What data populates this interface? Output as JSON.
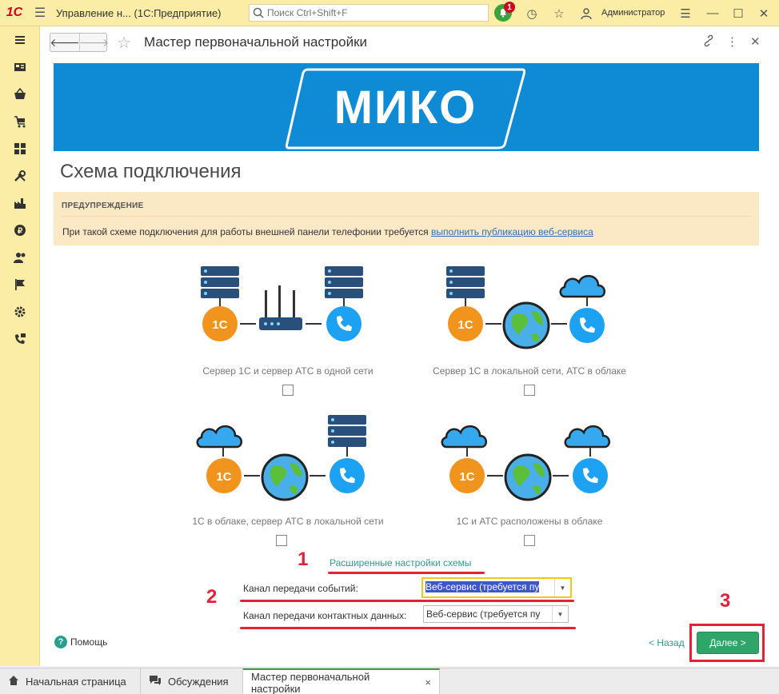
{
  "app": {
    "logo": "1С",
    "title": "Управление н...  (1С:Предприятие)",
    "search_placeholder": "Поиск Ctrl+Shift+F",
    "notifications_count": "1",
    "user": "Администратор"
  },
  "sidebar": {
    "items": [
      "menu-icon",
      "desktop-icon",
      "purchases-icon",
      "sales-icon",
      "catalog-icon",
      "tools-icon",
      "production-icon",
      "finance-icon",
      "contacts-icon",
      "flag-icon",
      "settings-icon",
      "telephony-icon"
    ]
  },
  "form": {
    "title": "Мастер первоначальной настройки",
    "banner_logo": "МИКО",
    "section_title": "Схема подключения",
    "warning": {
      "heading": "ПРЕДУПРЕЖДЕНИЕ",
      "text": "При такой схеме подключения для работы внешней панели телефонии требуется ",
      "link": "выполнить публикацию веб-сервиса"
    },
    "schemas": [
      {
        "label": "Сервер 1С и сервер АТС в одной сети",
        "checked": false
      },
      {
        "label": "Сервер 1С в локальной сети, АТС в облаке",
        "checked": false
      },
      {
        "label": "1С в облаке, сервер АТС в локальной сети",
        "checked": false
      },
      {
        "label": "1С и АТС расположены в облаке",
        "checked": false
      }
    ],
    "advanced_link": "Расширенные настройки схемы",
    "event_channel_label": "Канал передачи событий:",
    "event_channel_value": "Веб-сервис (требуется пу",
    "contact_channel_label": "Канал передачи контактных данных:",
    "contact_channel_value": "Веб-сервис (требуется пу",
    "help": "Помощь",
    "back": "< Назад",
    "next": "Далее >"
  },
  "annotations": [
    "1",
    "2",
    "3"
  ],
  "tabs": [
    {
      "label": "Начальная страница",
      "icon": "home-icon"
    },
    {
      "label": "Обсуждения",
      "icon": "chat-icon"
    },
    {
      "label": "Мастер первоначальной настройки",
      "close": "×"
    }
  ],
  "colors": {
    "panel": "#fbeda6",
    "banner": "#0f8bd6",
    "accent": "#2fa56a",
    "annotation": "#e3223a",
    "onec_orange": "#f0941e",
    "phone_blue": "#1da1f2"
  }
}
